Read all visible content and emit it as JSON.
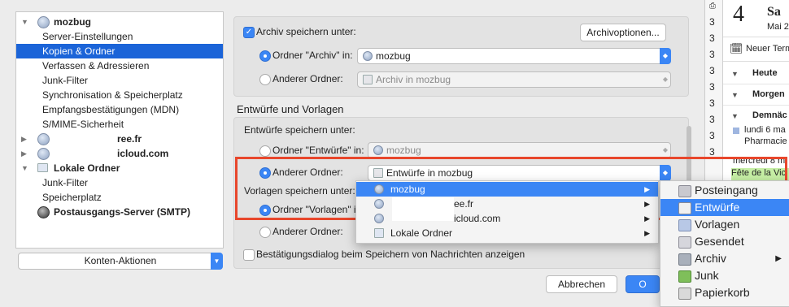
{
  "sidebar": {
    "items": [
      {
        "label": "mozbug"
      },
      {
        "label": "Server-Einstellungen"
      },
      {
        "label": "Kopien & Ordner"
      },
      {
        "label": "Verfassen & Adressieren"
      },
      {
        "label": "Junk-Filter"
      },
      {
        "label": "Synchronisation & Speicherplatz"
      },
      {
        "label": "Empfangsbestätigungen (MDN)"
      },
      {
        "label": "S/MIME-Sicherheit"
      },
      {
        "label": "ree.fr"
      },
      {
        "label": "icloud.com"
      },
      {
        "label": "Lokale Ordner"
      },
      {
        "label": "Junk-Filter"
      },
      {
        "label": "Speicherplatz"
      },
      {
        "label": "Postausgangs-Server (SMTP)"
      }
    ],
    "accounts_action": "Konten-Aktionen"
  },
  "archive": {
    "checkbox_label": "Archiv speichern unter:",
    "options_button": "Archivoptionen...",
    "radio1_label": "Ordner \"Archiv\" in:",
    "radio1_value": "mozbug",
    "radio2_label": "Anderer Ordner:",
    "radio2_value": "Archiv in mozbug"
  },
  "drafts": {
    "section_title": "Entwürfe und Vorlagen",
    "drafts_heading": "Entwürfe speichern unter:",
    "radio1_label": "Ordner \"Entwürfe\" in:",
    "radio1_value": "mozbug",
    "radio2_label": "Anderer Ordner:",
    "radio2_value": "Entwürfe in mozbug",
    "templates_heading": "Vorlagen speichern unter:",
    "templates_radio1_label": "Ordner \"Vorlagen\" in:",
    "templates_radio2_label": "Anderer Ordner:",
    "confirm_checkbox": "Bestätigungsdialog beim Speichern von Nachrichten anzeigen"
  },
  "buttons": {
    "cancel": "Abbrechen",
    "ok": "O"
  },
  "dropdown": {
    "items": [
      {
        "label": "mozbug"
      },
      {
        "label": "ee.fr"
      },
      {
        "label": "icloud.com"
      },
      {
        "label": "Lokale Ordner"
      }
    ]
  },
  "submenu": {
    "items": [
      {
        "label": "Posteingang"
      },
      {
        "label": "Entwürfe"
      },
      {
        "label": "Vorlagen"
      },
      {
        "label": "Gesendet"
      },
      {
        "label": "Archiv"
      },
      {
        "label": "Junk"
      },
      {
        "label": "Papierkorb"
      }
    ]
  },
  "calendar": {
    "day_number": "4",
    "day_name": "Sa",
    "month": "Mai 2",
    "new_event": "Neuer Term",
    "today": "Heute",
    "tomorrow": "Morgen",
    "soon": "Demnäc",
    "event1_date": "lundi 6 ma",
    "event1_title": "Pharmacie",
    "event2_date": "mercredi 8 m",
    "event2_title": "Fête de la Vic"
  },
  "colors": {
    "accent": "#3b86f5",
    "selection": "#1b64d8",
    "highlight_box": "#e8472c",
    "event_green": "#c6efa5"
  }
}
